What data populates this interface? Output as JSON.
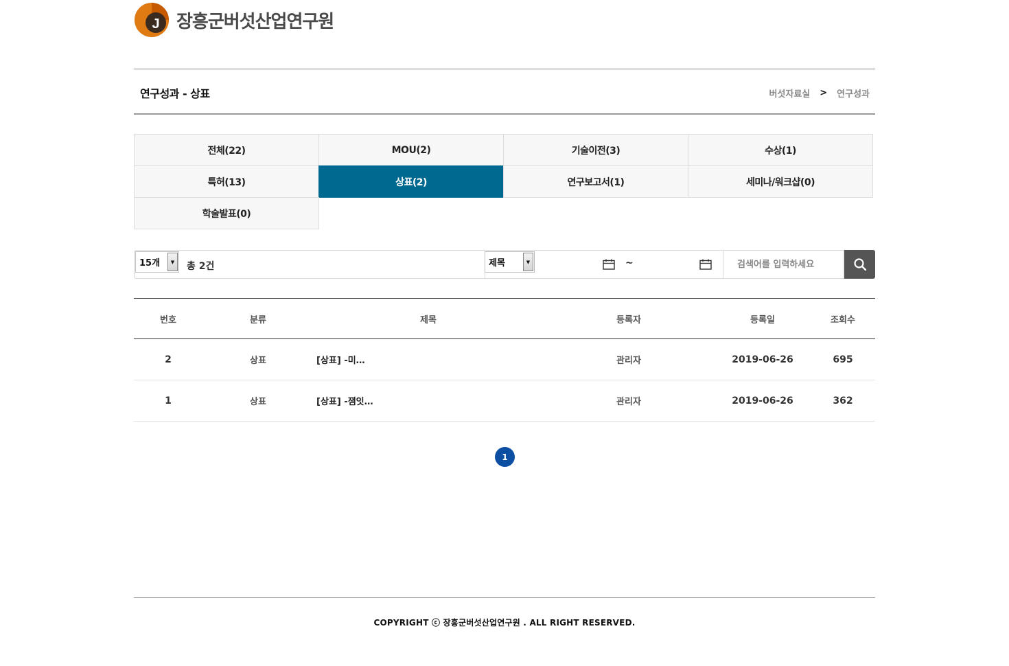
{
  "header": {
    "logo_text": "장흥군버섯산업연구원",
    "logo_letter": "J"
  },
  "title_bar": {
    "title": "연구성과 - 상표",
    "breadcrumb": [
      "버섯자료실",
      "연구성과"
    ],
    "breadcrumb_sep": ">"
  },
  "tabs": [
    {
      "label": "전체(22)",
      "active": false
    },
    {
      "label": "MOU(2)",
      "active": false
    },
    {
      "label": "기술이전(3)",
      "active": false
    },
    {
      "label": "수상(1)",
      "active": false
    },
    {
      "label": "특허(13)",
      "active": false
    },
    {
      "label": "상표(2)",
      "active": true
    },
    {
      "label": "연구보고서(1)",
      "active": false
    },
    {
      "label": "세미나/워크샵(0)",
      "active": false
    },
    {
      "label": "학술발표(0)",
      "active": false
    }
  ],
  "search": {
    "page_size": "15개",
    "total": "총 2건",
    "field": "제목",
    "tilde": "~",
    "placeholder": "검색어를 입력하세요"
  },
  "table": {
    "headers": [
      "번호",
      "분류",
      "제목",
      "등록자",
      "등록일",
      "조회수"
    ],
    "rows": [
      {
        "no": "2",
        "category": "상표",
        "subject": "[상표] -미…",
        "writer": "관리자",
        "date": "2019-06-26",
        "views": "695"
      },
      {
        "no": "1",
        "category": "상표",
        "subject": "[상표] -잼잇…",
        "writer": "관리자",
        "date": "2019-06-26",
        "views": "362"
      }
    ]
  },
  "pagination": {
    "current": "1"
  },
  "footer": {
    "copyright": "COPYRIGHT ⓒ 장흥군버섯산업연구원 . ALL RIGHT RESERVED."
  },
  "colors": {
    "active_tab": "#00698f",
    "pager": "#0b4ea2",
    "search_button": "#555555",
    "logo_orange": "#e07a12"
  }
}
